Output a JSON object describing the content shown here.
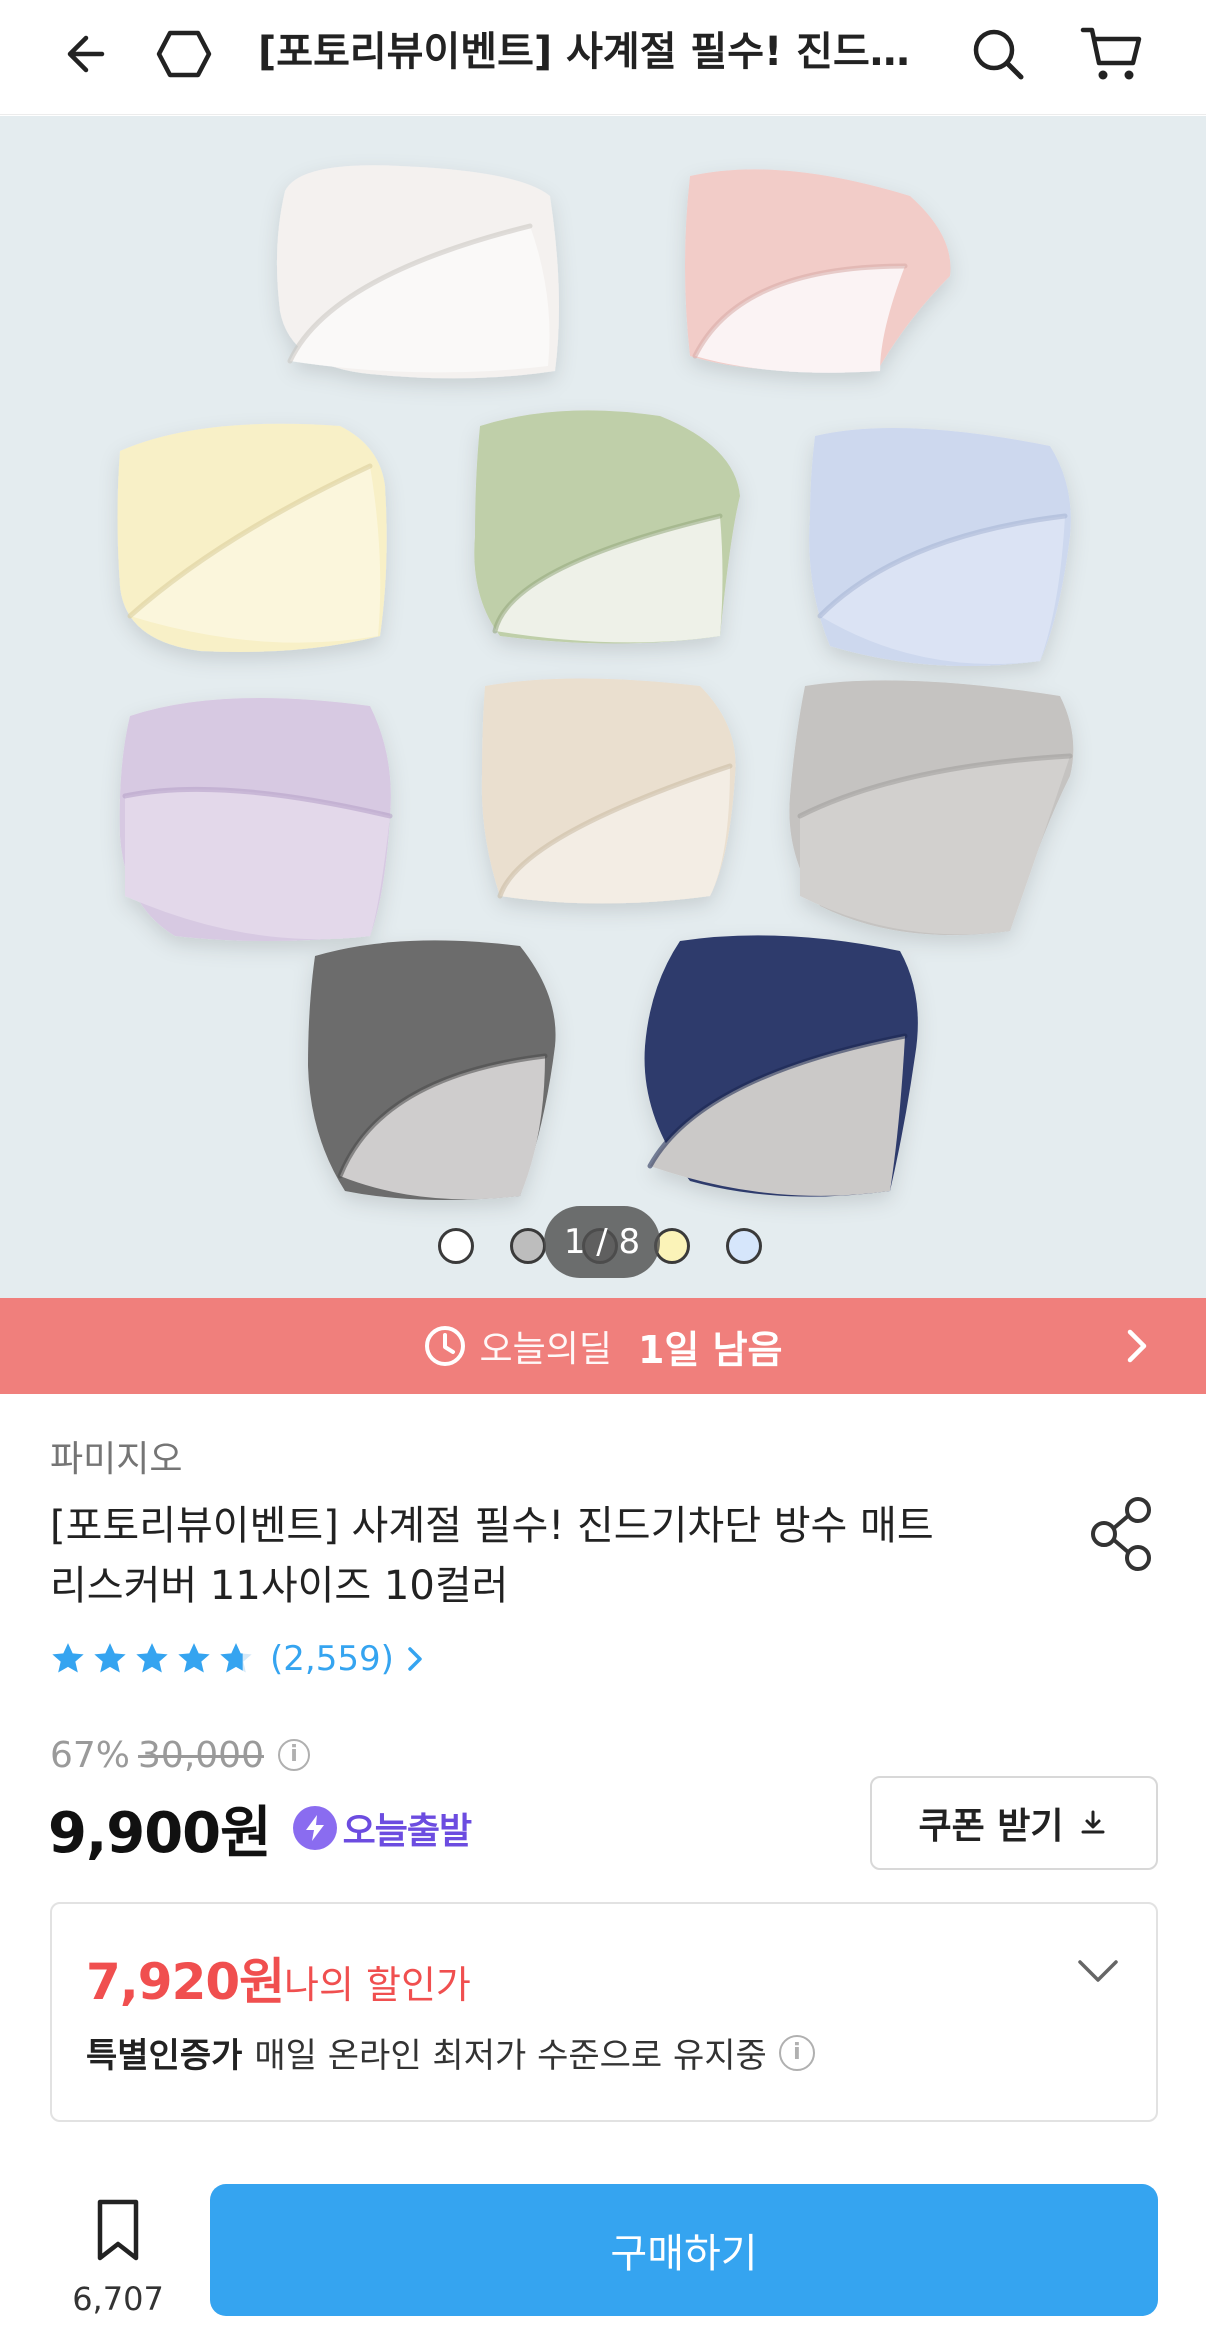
{
  "header": {
    "title": "[포토리뷰이벤트] 사계절 필수! 진드기차단 방수 매트리스커버 11사이즈 10컬러",
    "back_icon": "arrow-left-icon",
    "home_icon": "home-icon",
    "search_icon": "search-icon",
    "cart_icon": "cart-icon"
  },
  "gallery": {
    "counter": "1 / 8",
    "current": 1,
    "total": 8,
    "swatches": [
      "#ffffff",
      "#bdbdbd",
      "#9e9e9e",
      "#fbf3b8",
      "#d6e6fb"
    ]
  },
  "deal": {
    "label": "오늘의딜",
    "remaining": "1일 남음",
    "color": "#f07f7c"
  },
  "product": {
    "brand": "파미지오",
    "title": "[포토리뷰이벤트] 사계절 필수! 진드기차단 방수 매트리스커버 11사이즈 10컬러",
    "rating": 4.7,
    "review_count": "(2,559)",
    "discount_percent": "67%",
    "original_price": "30,000",
    "price": "9,900원",
    "shipping_badge": "오늘출발",
    "coupon_button": "쿠폰 받기"
  },
  "my_discount": {
    "price": "7,920원",
    "label": "나의 할인가",
    "cert_title": "특별인증가",
    "cert_desc": "매일 온라인 최저가 수준으로 유지중"
  },
  "bottom_bar": {
    "bookmark_count": "6,707",
    "buy_button": "구매하기",
    "accent": "#35a4f0"
  }
}
